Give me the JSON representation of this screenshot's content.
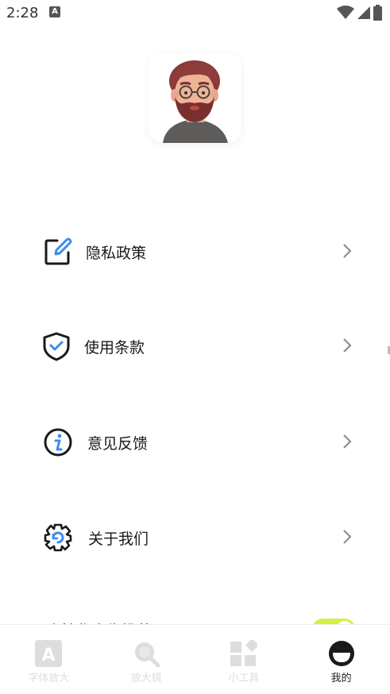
{
  "status_bar": {
    "time": "2:28",
    "notification_icon": "font-app-icon",
    "wifi_icon": "wifi-icon",
    "signal_icon": "signal-icon",
    "battery_icon": "battery-icon"
  },
  "profile": {
    "avatar_icon": "avatar-memoji"
  },
  "menu": {
    "items": [
      {
        "label": "隐私政策",
        "icon": "edit-icon"
      },
      {
        "label": "使用条款",
        "icon": "shield-check-icon"
      },
      {
        "label": "意见反馈",
        "icon": "info-icon"
      },
      {
        "label": "关于我们",
        "icon": "gear-icon"
      }
    ],
    "ad_recommend": {
      "label": "个性化广告推荐",
      "enabled": true
    }
  },
  "bottom_nav": {
    "items": [
      {
        "label": "字体放大",
        "icon": "font-a-icon",
        "active": false
      },
      {
        "label": "放大镜",
        "icon": "magnifier-icon",
        "active": false
      },
      {
        "label": "小工具",
        "icon": "widgets-icon",
        "active": false
      },
      {
        "label": "我的",
        "icon": "profile-icon",
        "active": true
      }
    ]
  },
  "colors": {
    "accent_blue": "#3b8cf0",
    "toggle_on": "#d8ef47",
    "inactive_nav": "#dddddd",
    "active_nav": "#222222"
  }
}
